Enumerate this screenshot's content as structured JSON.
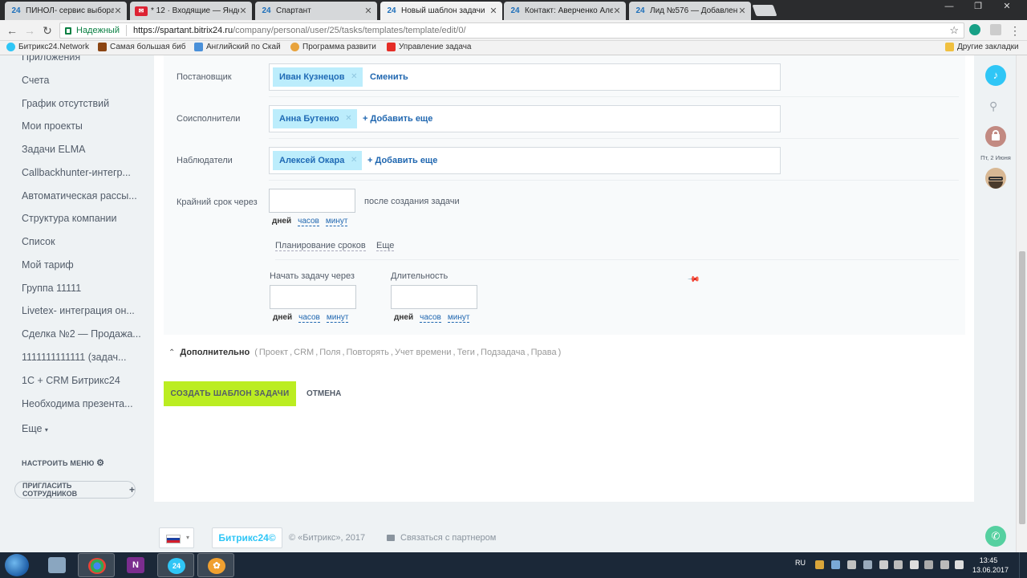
{
  "browser": {
    "tabs": [
      {
        "label": "ПИНОЛ- сервис выбора",
        "fav": "24"
      },
      {
        "label": "* 12 · Входящие — Янде",
        "fav": "✉"
      },
      {
        "label": "Спартант",
        "fav": "24"
      },
      {
        "label": "Новый шаблон задачи",
        "fav": "24",
        "active": true
      },
      {
        "label": "Контакт: Аверченко Але",
        "fav": "24"
      },
      {
        "label": "Лид №576 — Добавлен",
        "fav": "24"
      }
    ],
    "window_controls": [
      "—",
      "❐",
      "✕"
    ],
    "secure_label": "Надежный",
    "url_host": "https://spartant.bitrix24.ru",
    "url_path": "/company/personal/user/25/tasks/templates/template/edit/0/",
    "bookmarks": [
      {
        "label": "Битрикс24.Network",
        "color": "#2fc6f6"
      },
      {
        "label": "Самая большая биб",
        "color": "#8b4513"
      },
      {
        "label": "Английский по Скай",
        "color": "#4a90d9"
      },
      {
        "label": "Программа развити",
        "color": "#e8a33d"
      },
      {
        "label": "Управление задача",
        "color": "#e52d27"
      }
    ],
    "other_bookmarks": "Другие закладки"
  },
  "sidebar": {
    "top_partial": "Приложения",
    "items": [
      "Счета",
      "График отсутствий",
      "Мои проекты",
      "Задачи ELMA",
      "Callbackhunter-интегр...",
      "Автоматическая рассы...",
      "Структура компании",
      "Список",
      "Мой тариф",
      "Группа 11111",
      "Livetex- интеграция он...",
      "Сделка №2 — Продажа...",
      "1111111111111 (задач...",
      "1С + CRM Битрикс24",
      "Необходима презента..."
    ],
    "more": "Еще",
    "configure": "НАСТРОИТЬ МЕНЮ",
    "invite": "ПРИГЛАСИТЬ СОТРУДНИКОВ"
  },
  "form": {
    "creator": {
      "label": "Постановщик",
      "value": "Иван Кузнецов",
      "action": "Сменить"
    },
    "coexec": {
      "label": "Соисполнители",
      "value": "Анна Бутенко",
      "action": "Добавить еще"
    },
    "observers": {
      "label": "Наблюдатели",
      "value": "Алексей Окара",
      "action": "Добавить еще"
    },
    "deadline": {
      "label": "Крайний срок через",
      "value": "",
      "after": "после создания задачи"
    },
    "units": {
      "days": "дней",
      "hours": "часов",
      "minutes": "минут"
    },
    "planning": "Планирование сроков",
    "more": "Еще",
    "start_after": {
      "label": "Начать задачу через",
      "value": ""
    },
    "duration": {
      "label": "Длительность",
      "value": ""
    }
  },
  "additional": {
    "title": "Дополнительно",
    "options": [
      "Проект",
      "CRM",
      "Поля",
      "Повторять",
      "Учет времени",
      "Теги",
      "Подзадача",
      "Права"
    ]
  },
  "buttons": {
    "create": "СОЗДАТЬ ШАБЛОН ЗАДАЧИ",
    "cancel": "ОТМЕНА"
  },
  "footer": {
    "logo": "Битрикс24©",
    "copyright": "© «Битрикс», 2017",
    "partner": "Связаться с партнером"
  },
  "rightbar": {
    "date": "Пт, 2 Июня"
  },
  "taskbar": {
    "lang": "RU",
    "time": "13:45",
    "date": "13.06.2017"
  },
  "colors": {
    "accent_button": "#bbed21",
    "chip_bg": "#bcedfc",
    "link": "#2067b0",
    "bell": "#2fc6f6"
  }
}
